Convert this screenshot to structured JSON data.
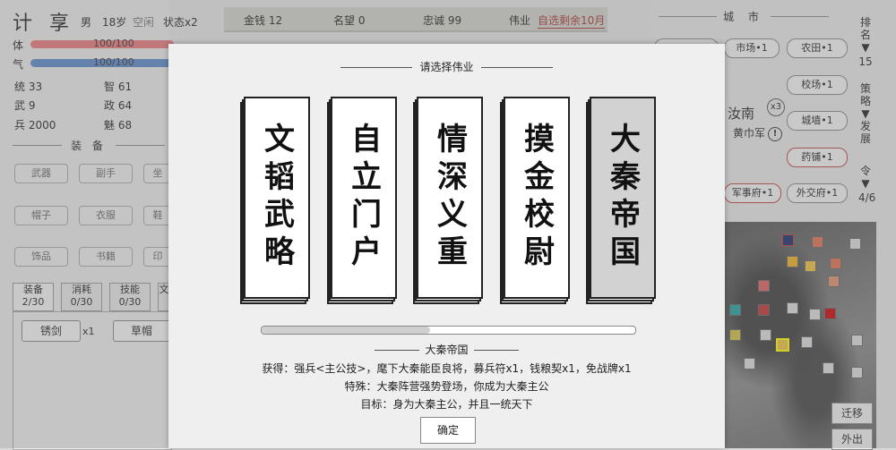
{
  "player": {
    "name": "计 享",
    "gender": "男",
    "age": "18岁",
    "status_idle": "空闲",
    "status_count": "状态x2",
    "hp_label": "体",
    "hp_text": "100/100",
    "hp_fraction": 1.0,
    "qi_label": "气",
    "qi_text": "100/100",
    "qi_fraction": 1.0,
    "stats": [
      {
        "label": "统 33"
      },
      {
        "label": "智 61"
      },
      {
        "label": "武 9"
      },
      {
        "label": "政 64"
      },
      {
        "label": "兵 2000"
      },
      {
        "label": "魅 68"
      }
    ]
  },
  "equipment": {
    "title": "装 备",
    "slots": [
      "武器",
      "副手",
      "坐",
      "帽子",
      "衣服",
      "鞋",
      "饰品",
      "书籍",
      "印"
    ]
  },
  "inventory": {
    "tabs": [
      {
        "label": "装备",
        "count": "2/30"
      },
      {
        "label": "消耗",
        "count": "0/30"
      },
      {
        "label": "技能",
        "count": "0/30"
      },
      {
        "label": "文",
        "count": ""
      }
    ],
    "items": [
      {
        "name": "锈剑",
        "qty": "x1"
      },
      {
        "name": "草帽",
        "qty": ""
      }
    ]
  },
  "resources": {
    "gold": "金钱 12",
    "fame": "名望 0",
    "loyalty": "忠诚 99",
    "feat_label": "伟业",
    "feat_value": "自选剩余10月"
  },
  "city": {
    "title": "城 市",
    "buildings": [
      "市场•1",
      "农田•1",
      "校场•1",
      "城墙•1",
      "药铺•1",
      "军事府•1",
      "外交府•1"
    ],
    "army_name": "汝南",
    "army_count": "x3",
    "army_faction": "黄巾军",
    "rank_label": "排名▼",
    "rank_value": "15",
    "strategy_label": "策略▼发展",
    "command_label": "令▼",
    "command_value": "4/6",
    "migrate_button": "迁移",
    "out_button": "外出"
  },
  "modal": {
    "title": "请选择伟业",
    "cards": [
      "文韬武略",
      "自立门户",
      "情深义重",
      "摸金校尉",
      "大秦帝国"
    ],
    "selected_index": 4,
    "scroll_fraction": 0.45,
    "selected_title": "大秦帝国",
    "reward": "获得：强兵<主公技>，麾下大秦能臣良将，募兵符x1，钱粮契x1，免战牌x1",
    "special": "特殊：大秦阵营强势登场，你成为大秦主公",
    "goal": "目标：身为大秦主公，并且一统天下",
    "confirm_label": "确定"
  },
  "colors": {
    "hp_bar": "#e87878",
    "qi_bar": "#5b87c8",
    "highlight_red": "#aa3333"
  }
}
